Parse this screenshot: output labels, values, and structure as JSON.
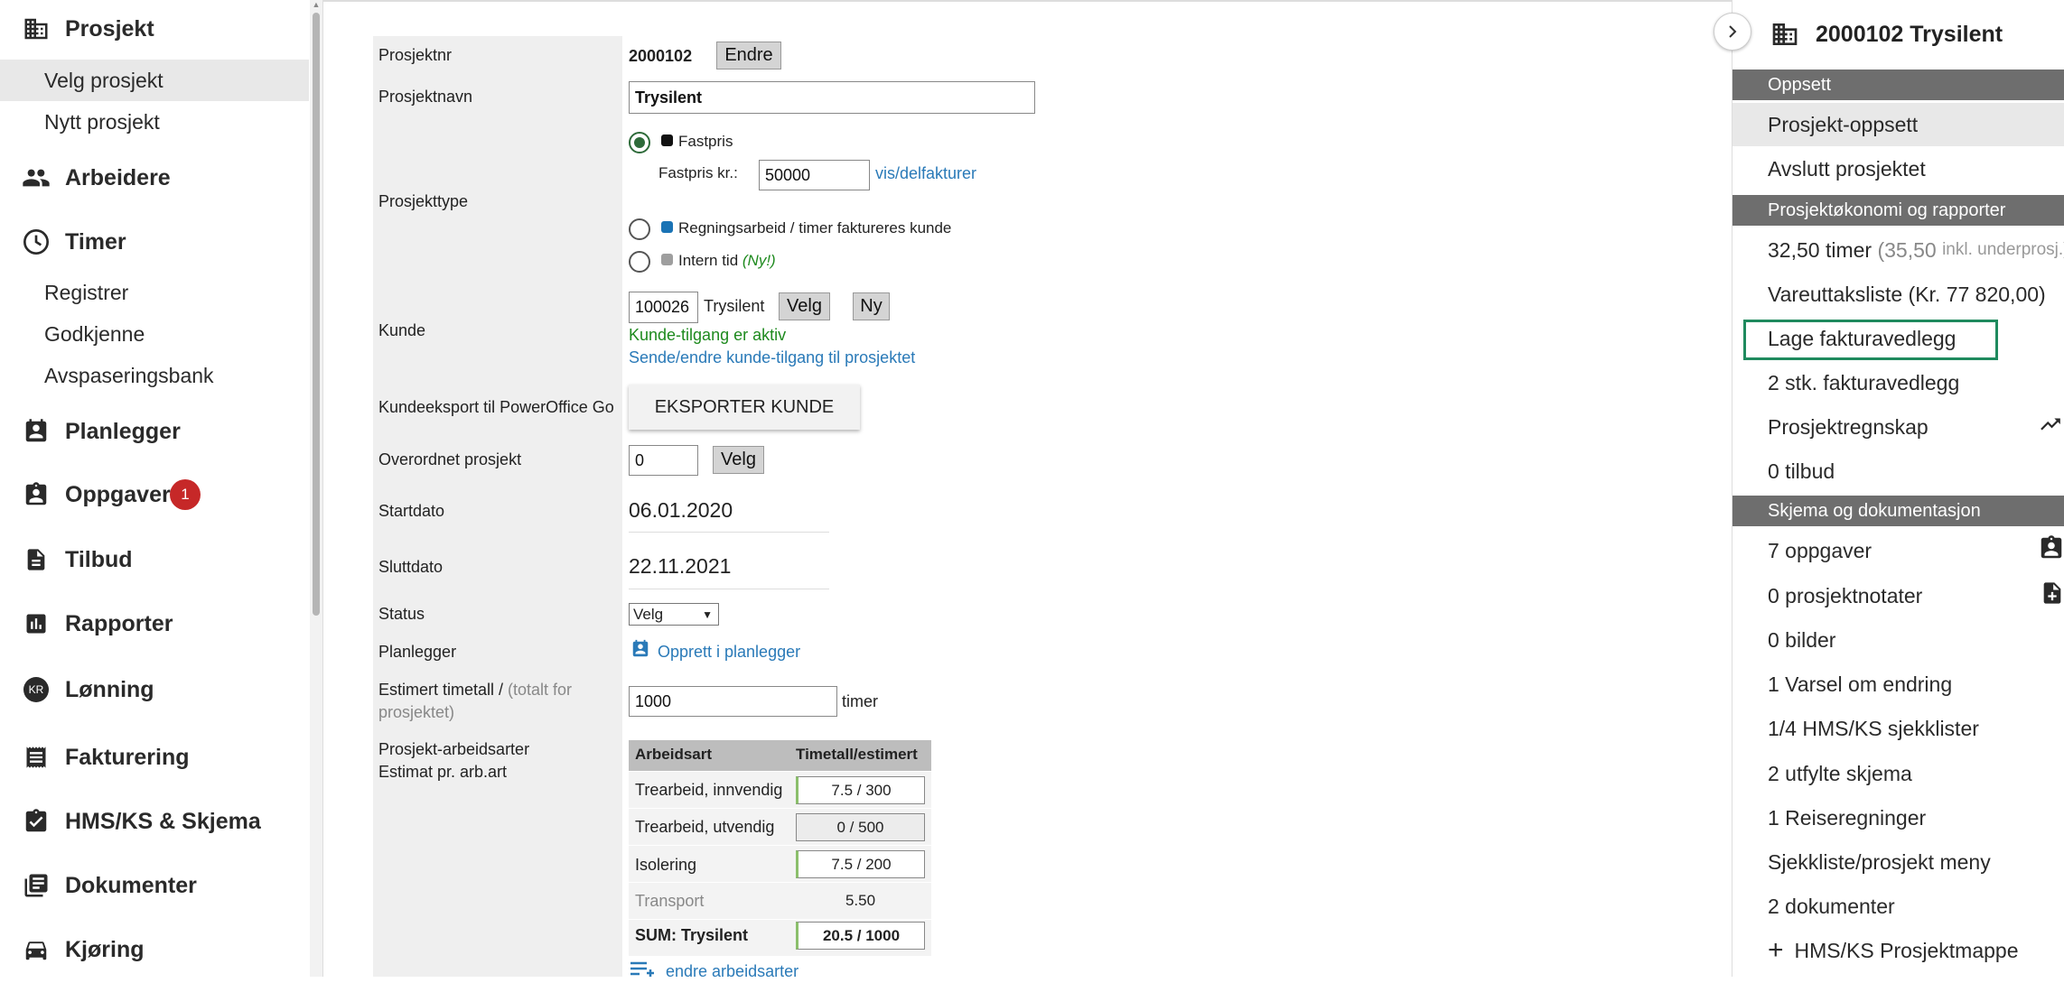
{
  "sidebar": {
    "prosjekt": "Prosjekt",
    "velg_prosjekt": "Velg prosjekt",
    "nytt_prosjekt": "Nytt prosjekt",
    "arbeidere": "Arbeidere",
    "timer": "Timer",
    "registrer": "Registrer",
    "godkjenne": "Godkjenne",
    "avspaseringsbank": "Avspaseringsbank",
    "planlegger": "Planlegger",
    "oppgaver": "Oppgaver",
    "oppgaver_badge": "1",
    "tilbud": "Tilbud",
    "rapporter": "Rapporter",
    "lonning": "Lønning",
    "lonning_icon_text": "KR",
    "fakturering": "Fakturering",
    "hms": "HMS/KS & Skjema",
    "dokumenter": "Dokumenter",
    "kjoring": "Kjøring"
  },
  "form": {
    "prosjektnr_label": "Prosjektnr",
    "prosjektnr_value": "2000102",
    "endre_button": "Endre",
    "prosjektnavn_label": "Prosjektnavn",
    "prosjektnavn_value": "Trysilent",
    "prosjekttype_label": "Prosjekttype",
    "fastpris_label": "Fastpris",
    "fastpris_kr_label": "Fastpris kr.:",
    "fastpris_kr_value": "50000",
    "vis_delfakturer": "vis/delfakturer",
    "regning_label": "Regningsarbeid / timer faktureres kunde",
    "intern_label": "Intern tid",
    "intern_new": "(Ny!)",
    "kunde_label": "Kunde",
    "kunde_nr": "100026",
    "kunde_navn": "Trysilent",
    "velg_button": "Velg",
    "ny_button": "Ny",
    "kunde_tilgang": "Kunde-tilgang er aktiv",
    "sende_tilgang": "Sende/endre kunde-tilgang til prosjektet",
    "kundeeksport_label": "Kundeeksport til PowerOffice Go",
    "eksporter_button": "EKSPORTER KUNDE",
    "overordnet_label": "Overordnet prosjekt",
    "overordnet_value": "0",
    "overordnet_velg": "Velg",
    "startdato_label": "Startdato",
    "startdato_value": "06.01.2020",
    "sluttdato_label": "Sluttdato",
    "sluttdato_value": "22.11.2021",
    "status_label": "Status",
    "status_value": "Velg",
    "planlegger_label": "Planlegger",
    "planlegger_link": "Opprett i planlegger",
    "estimert_label_a": "Estimert timetall / ",
    "estimert_label_b": "(totalt for",
    "estimert_label_c": "prosjektet)",
    "estimert_value": "1000",
    "estimert_unit": "timer",
    "arbeidsarter_label_1": "Prosjekt-arbeidsarter",
    "arbeidsarter_label_2": "Estimat pr. arb.art",
    "endre_arbeidsarter": "endre arbeidsarter"
  },
  "arb_table": {
    "headers": [
      "Arbeidsart",
      "Timetall/estimert"
    ],
    "rows": [
      {
        "name": "Trearbeid, innvendig",
        "value": "7.5 / 300"
      },
      {
        "name": "Trearbeid, utvendig",
        "value": "0 / 500"
      },
      {
        "name": "Isolering",
        "value": "7.5 / 200"
      },
      {
        "name": "Transport",
        "value": "5.50"
      },
      {
        "name": "SUM: Trysilent",
        "value": "20.5 / 1000"
      }
    ]
  },
  "rpanel": {
    "title": "2000102 Trysilent",
    "oppsett_head": "Oppsett",
    "prosjekt_oppsett": "Prosjekt-oppsett",
    "avslutt": "Avslutt prosjektet",
    "okonomi_head": "Prosjektøkonomi og rapporter",
    "timer_main": "32,50 timer ",
    "timer_paren": "(35,50 ",
    "timer_small": "inkl. underprosj.)",
    "vareuttak": "Vareuttaksliste (Kr. 77 820,00)",
    "lage_fakturavedlegg": "Lage fakturavedlegg",
    "fakturavedlegg": "2 stk. fakturavedlegg",
    "prosjektregnskap": "Prosjektregnskap",
    "tilbud": "0 tilbud",
    "skjema_head": "Skjema og dokumentasjon",
    "oppgaver": "7 oppgaver",
    "prosjektnotater": "0 prosjektnotater",
    "bilder": "0 bilder",
    "varsel": "1 Varsel om endring",
    "hms_sjekklister": "1/4 HMS/KS sjekklister",
    "utfylte_skjema": "2 utfylte skjema",
    "reiseregninger": "1 Reiseregninger",
    "sjekkliste_meny": "Sjekkliste/prosjekt meny",
    "dokumenter": "2 dokumenter",
    "hms_mappe": "HMS/KS Prosjektmappe"
  },
  "colors": {
    "accent_green": "#1e8a1e",
    "link_blue": "#2a7ab8",
    "badge_red": "#c62828",
    "section_gray": "#6e6e6e"
  }
}
